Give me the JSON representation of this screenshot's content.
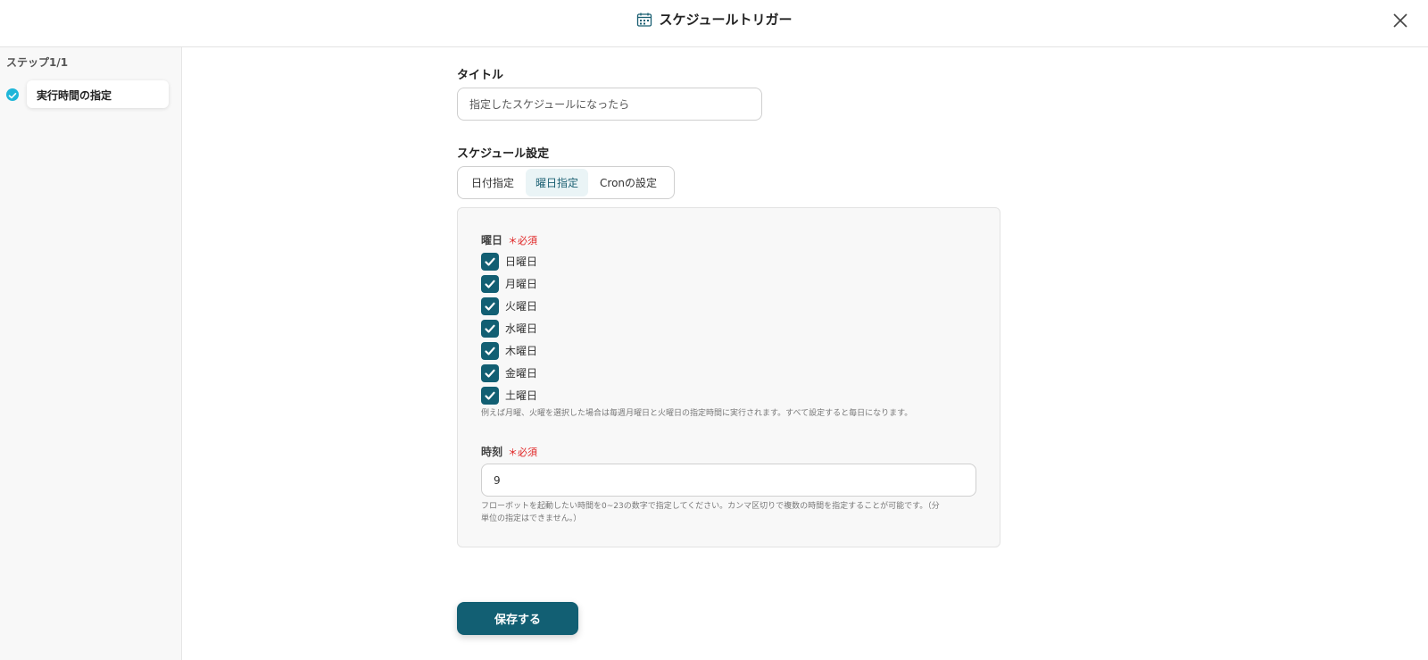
{
  "header": {
    "title": "スケジュールトリガー",
    "icon": "calendar-icon",
    "close_icon": "close-icon"
  },
  "sidebar": {
    "step_count": "ステップ1/1",
    "items": [
      {
        "label": "実行時間の指定",
        "status": "completed",
        "icon": "check-circle-icon"
      }
    ]
  },
  "form": {
    "title_label": "タイトル",
    "title_value": "指定したスケジュールになったら",
    "schedule_label": "スケジュール設定",
    "tabs": [
      {
        "label": "日付指定",
        "active": false
      },
      {
        "label": "曜日指定",
        "active": true
      },
      {
        "label": "Cronの設定",
        "active": false
      }
    ],
    "weekday_label": "曜日",
    "required_text": "＊必須",
    "days": [
      {
        "label": "日曜日",
        "checked": true
      },
      {
        "label": "月曜日",
        "checked": true
      },
      {
        "label": "火曜日",
        "checked": true
      },
      {
        "label": "水曜日",
        "checked": true
      },
      {
        "label": "木曜日",
        "checked": true
      },
      {
        "label": "金曜日",
        "checked": true
      },
      {
        "label": "土曜日",
        "checked": true
      }
    ],
    "weekday_hint": "例えば月曜、火曜を選択した場合は毎週月曜日と火曜日の指定時間に実行されます。すべて設定すると毎日になります。",
    "time_label": "時刻",
    "time_value": "9",
    "time_hint_line1": "フローボットを起動したい時間を0~23の数字で指定してください。カンマ区切りで複数の時間を指定することが可能です。（分",
    "time_hint_line2": "単位の指定はできません。）",
    "save_label": "保存する"
  },
  "colors": {
    "accent": "#125f73",
    "check_circle": "#1fb6d9",
    "required": "#e02424",
    "active_tab_bg": "#eaf4f6"
  }
}
